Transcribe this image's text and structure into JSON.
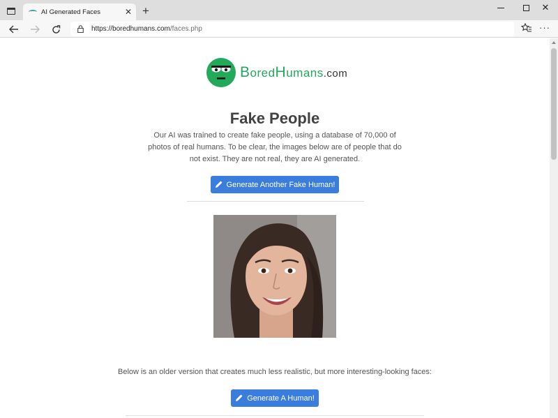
{
  "browser": {
    "tab_title": "AI Generated Faces",
    "tab_close": "✕",
    "new_tab": "+",
    "url_host": "https://boredhumans.com",
    "url_path": "/faces.php",
    "more": "···"
  },
  "logo": {
    "b": "B",
    "ored": "ored",
    "h": "H",
    "umans": "umans",
    "dotcom": ".com"
  },
  "page": {
    "title": "Fake People",
    "intro": "Our AI was trained to create fake people, using a database of 70,000 of photos of real humans. To be clear, the images below are of people that do not exist. They are not real, they are AI generated.",
    "generate_fake_label": "Generate Another Fake Human!",
    "older_text": "Below is an older version that creates much less realistic, but more interesting-looking faces:",
    "generate_human_label": "Generate A Human!"
  },
  "colors": {
    "accent": "#3b7ddd",
    "brand_green": "#22a95a",
    "title_text": "#424242"
  },
  "icons": [
    "tab-actions-icon",
    "back-arrow-icon",
    "forward-arrow-icon",
    "reload-icon",
    "lock-icon",
    "favorites-icon",
    "more-icon",
    "pencil-icon",
    "logo-face-icon"
  ]
}
